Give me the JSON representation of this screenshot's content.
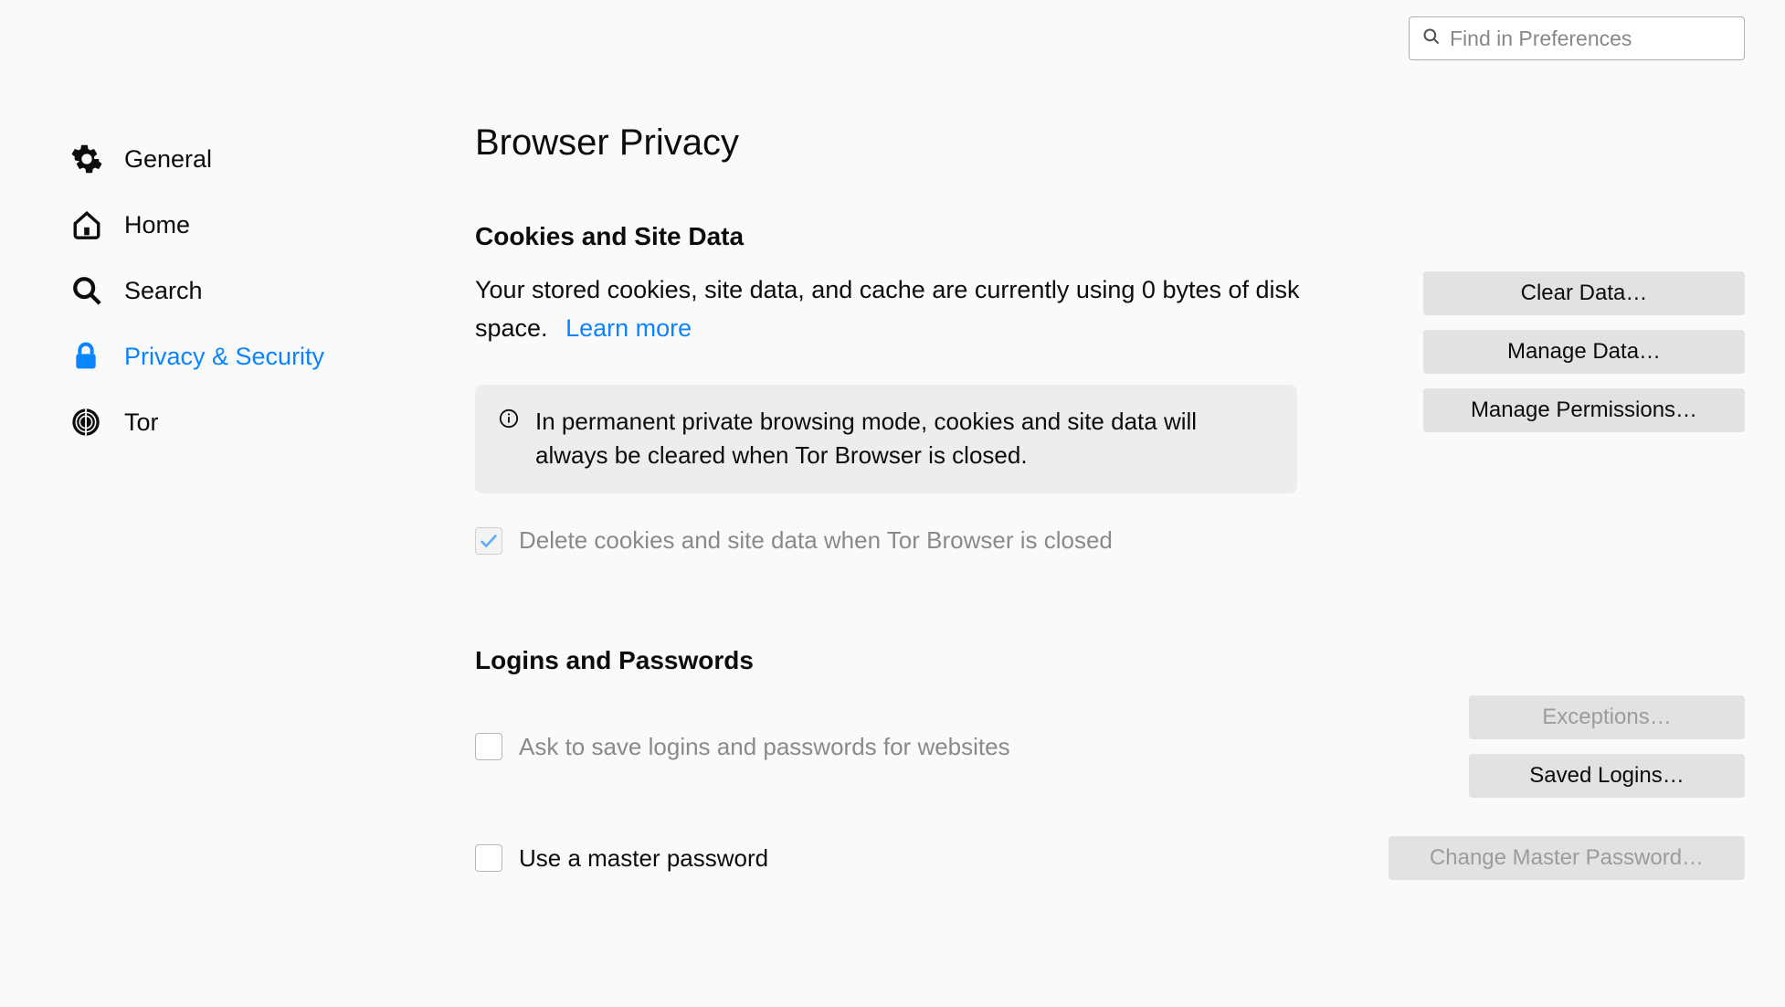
{
  "search": {
    "placeholder": "Find in Preferences"
  },
  "sidebar": {
    "items": [
      {
        "label": "General"
      },
      {
        "label": "Home"
      },
      {
        "label": "Search"
      },
      {
        "label": "Privacy & Security"
      },
      {
        "label": "Tor"
      }
    ]
  },
  "page": {
    "title": "Browser Privacy"
  },
  "cookies": {
    "heading": "Cookies and Site Data",
    "desc": "Your stored cookies, site data, and cache are currently using 0 bytes of disk space.",
    "learn_more": "Learn more",
    "info": "In permanent private browsing mode, cookies and site data will always be cleared when Tor Browser is closed.",
    "delete_label": "Delete cookies and site data when Tor Browser is closed",
    "buttons": {
      "clear": "Clear Data…",
      "manage_data": "Manage Data…",
      "manage_permissions": "Manage Permissions…"
    }
  },
  "logins": {
    "heading": "Logins and Passwords",
    "ask_label": "Ask to save logins and passwords for websites",
    "master_label": "Use a master password",
    "buttons": {
      "exceptions": "Exceptions…",
      "saved": "Saved Logins…",
      "change_master": "Change Master Password…"
    }
  }
}
